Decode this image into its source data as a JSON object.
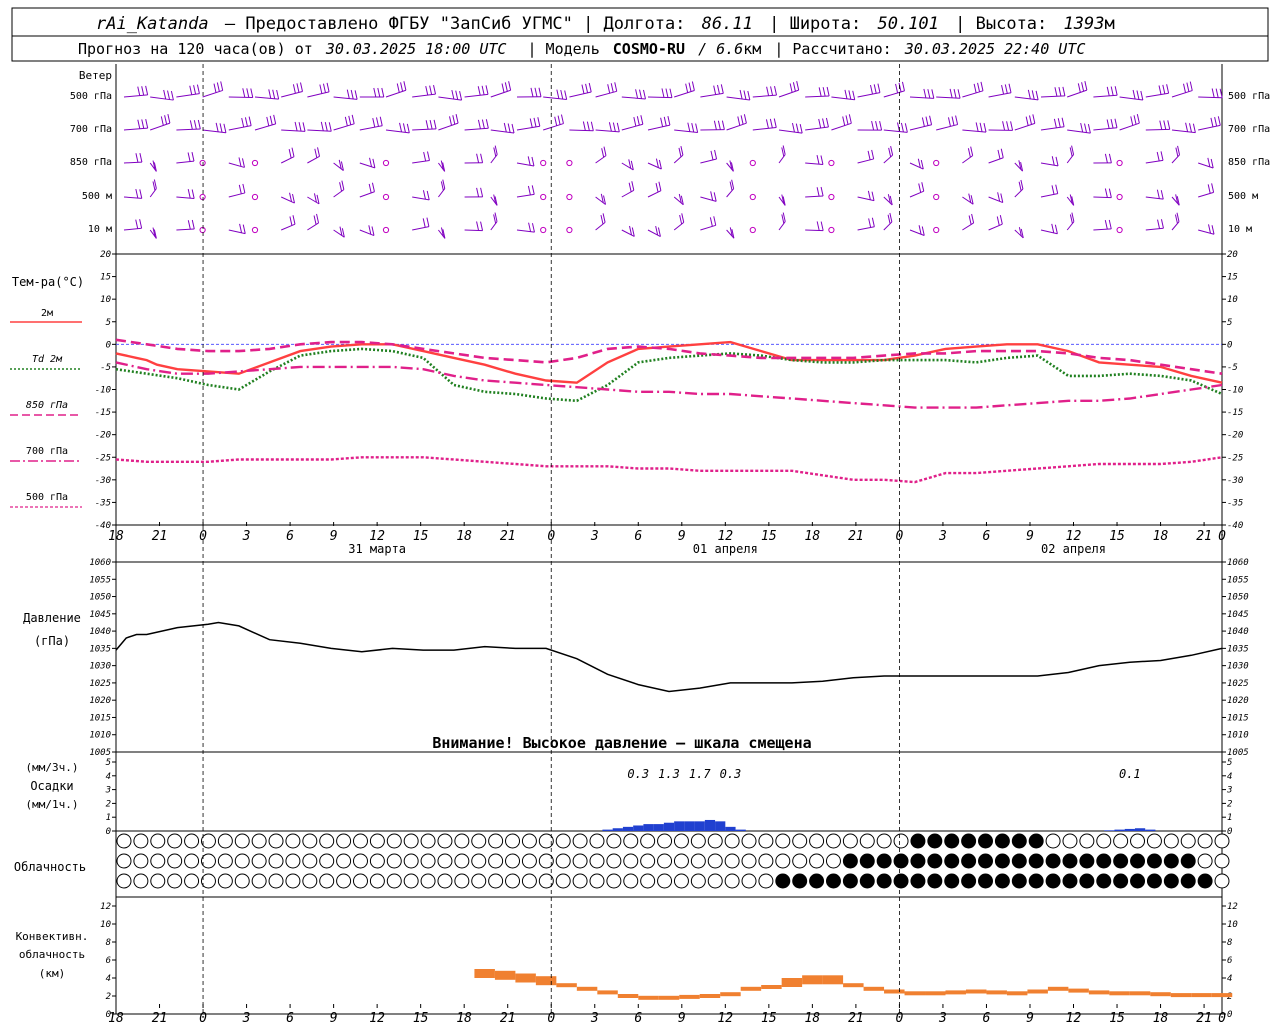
{
  "header": {
    "station": "rAi_Katanda",
    "provider": "— Предоставлено ФГБУ \"ЗапСиб УГМС\" | Долгота:",
    "lon": "86.11",
    "lat_label": "| Широта:",
    "lat": "50.101",
    "alt_label": "| Высота:",
    "alt": "1393",
    "alt_unit": "м",
    "line2_a": "Прогноз на 120 часа(ов) от",
    "run_time": "30.03.2025 18:00 UTC",
    "line2_b": "| Модель",
    "model": "COSMO-RU",
    "resolution": "/ 6.6",
    "res_unit": "км",
    "line2_c": "| Рассчитано:",
    "calc_time": "30.03.2025 22:40 UTC"
  },
  "wind_panel": {
    "title": "Ветер",
    "levels": [
      "500 гПа",
      "700 гПа",
      "850 гПа",
      "500 м",
      "10 м"
    ],
    "barb_color": "#8000c0",
    "calm_color": "#c000c0"
  },
  "temp_panel": {
    "title": "Тем-ра(°C)",
    "legend": [
      {
        "label": "2м",
        "color": "#ff4040",
        "style": "solid"
      },
      {
        "label": "Td  2м",
        "color": "#208020",
        "style": "dot"
      },
      {
        "label": "850 гПа",
        "color": "#e0208a",
        "style": "dash"
      },
      {
        "label": "700 гПа",
        "color": "#e0208a",
        "style": "dashdot"
      },
      {
        "label": "500 гПа",
        "color": "#e0208a",
        "style": "fine"
      }
    ]
  },
  "pressure_panel": {
    "title": "Давление",
    "unit": "(гПа)",
    "warning": "Внимание! Высокое давление — шкала смещена"
  },
  "precip_panel": {
    "unit3": "(мм/3ч.)",
    "title": "Осадки",
    "unit1": "(мм/1ч.)",
    "totals": [
      {
        "h": 51,
        "label": "0.3"
      },
      {
        "h": 54,
        "label": "1.3"
      },
      {
        "h": 57,
        "label": "1.7"
      },
      {
        "h": 60,
        "label": "0.3"
      },
      {
        "h": 99,
        "label": "0.1"
      }
    ]
  },
  "cloud_panel": {
    "title": "Облачность"
  },
  "conv_panel": {
    "title1": "Конвективн.",
    "title2": "облачность",
    "unit": "(км)"
  },
  "time_axis": {
    "hour_labels": [
      "18",
      "21",
      "0",
      "3",
      "6",
      "9",
      "12",
      "15",
      "18",
      "21",
      "0",
      "3",
      "6",
      "9",
      "12",
      "15",
      "18",
      "21",
      "0",
      "3",
      "6",
      "9",
      "12",
      "15",
      "18",
      "21",
      "0"
    ],
    "day_labels": [
      {
        "h": 18,
        "label": "31 марта"
      },
      {
        "h": 42,
        "label": "01 апреля"
      },
      {
        "h": 66,
        "label": "02 апреля"
      }
    ]
  },
  "chart_data": [
    {
      "type": "line",
      "title": "Тем-ра(°C)",
      "x_unit": "hours after 30.03.2025 18:00 UTC",
      "ylim": [
        -40,
        20
      ],
      "yticks": [
        -40,
        -35,
        -30,
        -25,
        -20,
        -15,
        -10,
        -5,
        0,
        5,
        10,
        15,
        20
      ],
      "series": [
        {
          "name": "2м",
          "color": "#ff4040",
          "x": [
            0,
            2,
            3,
            4,
            6,
            9,
            12,
            15,
            18,
            21,
            24,
            27,
            30,
            33,
            36,
            39,
            42,
            45,
            48,
            51,
            54,
            57,
            60,
            63,
            66,
            69,
            72,
            75,
            78,
            81,
            84,
            87,
            90,
            93,
            96,
            99,
            102,
            105,
            108
          ],
          "y": [
            -2,
            -3,
            -3.5,
            -4.5,
            -5.5,
            -6,
            -6.5,
            -4,
            -1.5,
            -0.5,
            0,
            0,
            -1.5,
            -3,
            -4.5,
            -6.5,
            -8,
            -8.5,
            -4,
            -1,
            -0.5,
            0,
            0.5,
            -1.5,
            -3.5,
            -3.5,
            -3.5,
            -3.5,
            -2.5,
            -1,
            -0.5,
            0,
            0,
            -1.5,
            -4,
            -4.5,
            -5,
            -7,
            -8.5
          ]
        },
        {
          "name": "Td  2м",
          "color": "#208020",
          "x": [
            0,
            3,
            6,
            9,
            12,
            15,
            18,
            21,
            24,
            27,
            30,
            33,
            36,
            39,
            42,
            45,
            48,
            51,
            54,
            57,
            60,
            63,
            66,
            69,
            72,
            75,
            78,
            81,
            84,
            87,
            90,
            93,
            96,
            99,
            102,
            105,
            108
          ],
          "y": [
            -5.5,
            -6.5,
            -7.5,
            -9,
            -10,
            -6,
            -2.5,
            -1.5,
            -1,
            -1.5,
            -3,
            -9,
            -10.5,
            -11,
            -12,
            -12.5,
            -9,
            -4,
            -3,
            -2.5,
            -2,
            -2.5,
            -3.5,
            -4,
            -4,
            -3.5,
            -3.5,
            -3.5,
            -4,
            -3,
            -2.5,
            -7,
            -7,
            -6.5,
            -7,
            -8,
            -11
          ]
        },
        {
          "name": "850 гПа",
          "color": "#e0208a",
          "x": [
            0,
            3,
            6,
            9,
            12,
            15,
            18,
            21,
            24,
            27,
            30,
            33,
            36,
            39,
            42,
            45,
            48,
            51,
            54,
            57,
            60,
            63,
            66,
            69,
            72,
            75,
            78,
            81,
            84,
            87,
            90,
            93,
            96,
            99,
            102,
            105,
            108
          ],
          "y": [
            1,
            0,
            -1,
            -1.5,
            -1.5,
            -1,
            0,
            0.5,
            0.5,
            0,
            -1,
            -2,
            -3,
            -3.5,
            -4,
            -3,
            -1,
            -0.5,
            -1,
            -2,
            -2.5,
            -3,
            -3,
            -3,
            -3,
            -2.5,
            -2,
            -2,
            -1.5,
            -1.5,
            -1.5,
            -2,
            -3,
            -3.5,
            -4.5,
            -5.5,
            -6.5
          ]
        },
        {
          "name": "700 гПа",
          "color": "#e0208a",
          "x": [
            0,
            3,
            6,
            9,
            12,
            15,
            18,
            21,
            24,
            27,
            30,
            33,
            36,
            39,
            42,
            45,
            48,
            51,
            54,
            57,
            60,
            63,
            66,
            69,
            72,
            75,
            78,
            81,
            84,
            87,
            90,
            93,
            96,
            99,
            102,
            105,
            108
          ],
          "y": [
            -4,
            -5.5,
            -6.5,
            -6.5,
            -6,
            -5.5,
            -5,
            -5,
            -5,
            -5,
            -5.5,
            -7,
            -8,
            -8.5,
            -9,
            -9.5,
            -10,
            -10.5,
            -10.5,
            -11,
            -11,
            -11.5,
            -12,
            -12.5,
            -13,
            -13.5,
            -14,
            -14,
            -14,
            -13.5,
            -13,
            -12.5,
            -12.5,
            -12,
            -11,
            -10,
            -9
          ]
        },
        {
          "name": "500 гПа",
          "color": "#e0208a",
          "x": [
            0,
            3,
            6,
            9,
            12,
            15,
            18,
            21,
            24,
            27,
            30,
            33,
            36,
            39,
            42,
            45,
            48,
            51,
            54,
            57,
            60,
            63,
            66,
            69,
            72,
            75,
            78,
            81,
            84,
            87,
            90,
            93,
            96,
            99,
            102,
            105,
            108
          ],
          "y": [
            -25.5,
            -26,
            -26,
            -26,
            -25.5,
            -25.5,
            -25.5,
            -25.5,
            -25,
            -25,
            -25,
            -25.5,
            -26,
            -26.5,
            -27,
            -27,
            -27,
            -27.5,
            -27.5,
            -28,
            -28,
            -28,
            -28,
            -29,
            -30,
            -30,
            -30.5,
            -28.5,
            -28.5,
            -28,
            -27.5,
            -27,
            -26.5,
            -26.5,
            -26.5,
            -26,
            -25
          ]
        }
      ]
    },
    {
      "type": "line",
      "title": "Давление",
      "ylabel": "(гПа)",
      "ylim": [
        1005,
        1060
      ],
      "yticks": [
        1005,
        1010,
        1015,
        1020,
        1025,
        1030,
        1035,
        1040,
        1045,
        1050,
        1055,
        1060
      ],
      "series": [
        {
          "name": "Давление",
          "color": "#000000",
          "x": [
            0,
            1,
            2,
            3,
            6,
            9,
            10,
            12,
            15,
            18,
            21,
            24,
            27,
            30,
            33,
            36,
            39,
            42,
            45,
            48,
            51,
            54,
            57,
            60,
            63,
            66,
            69,
            72,
            75,
            78,
            81,
            84,
            87,
            90,
            93,
            96,
            99,
            102,
            105,
            108
          ],
          "y": [
            1034.5,
            1038,
            1039,
            1039,
            1041,
            1042,
            1042.5,
            1041.5,
            1037.5,
            1036.5,
            1035,
            1034,
            1035,
            1034.5,
            1034.5,
            1035.5,
            1035,
            1035,
            1032,
            1027.5,
            1024.5,
            1022.5,
            1023.5,
            1025,
            1025,
            1025,
            1025.5,
            1026.5,
            1027,
            1027,
            1027,
            1027,
            1027,
            1027,
            1028,
            1030,
            1031,
            1031.5,
            1033,
            1035
          ]
        }
      ]
    },
    {
      "type": "bar",
      "title": "Осадки",
      "ylabel": "(мм/1ч.)",
      "ylim": [
        0,
        5
      ],
      "yticks": [
        0,
        1,
        2,
        3,
        4,
        5
      ],
      "series": [
        {
          "name": "Осадки",
          "color": "#2040d0",
          "x": [
            48,
            49,
            50,
            51,
            52,
            53,
            54,
            55,
            56,
            57,
            58,
            59,
            60,
            61,
            97,
            98,
            99,
            100,
            101
          ],
          "y": [
            0.1,
            0.2,
            0.3,
            0.4,
            0.5,
            0.5,
            0.6,
            0.7,
            0.7,
            0.7,
            0.8,
            0.7,
            0.3,
            0.1,
            0.05,
            0.1,
            0.15,
            0.2,
            0.1
          ]
        }
      ]
    },
    {
      "type": "bar",
      "title": "Конвективн. облачность",
      "ylabel": "(км)",
      "ylim": [
        0,
        13
      ],
      "yticks": [
        0,
        2,
        4,
        6,
        8,
        10,
        12
      ],
      "series": [
        {
          "name": "Конвективн. облачность",
          "color": "#f08030",
          "x": [
            36,
            38,
            40,
            42,
            44,
            46,
            48,
            50,
            52,
            54,
            56,
            58,
            60,
            62,
            64,
            66,
            68,
            70,
            72,
            74,
            76,
            78,
            80,
            82,
            84,
            86,
            88,
            90,
            92,
            94,
            96,
            98,
            100,
            102,
            104,
            106,
            108
          ],
          "y": [
            4.5,
            4.3,
            4.0,
            3.7,
            3.2,
            2.8,
            2.4,
            2.0,
            1.8,
            1.8,
            1.9,
            2.0,
            2.2,
            2.8,
            3.0,
            3.5,
            3.8,
            3.8,
            3.2,
            2.8,
            2.5,
            2.3,
            2.3,
            2.4,
            2.5,
            2.4,
            2.3,
            2.5,
            2.8,
            2.6,
            2.4,
            2.3,
            2.3,
            2.2,
            2.1,
            2.1,
            2.1
          ]
        }
      ]
    }
  ]
}
